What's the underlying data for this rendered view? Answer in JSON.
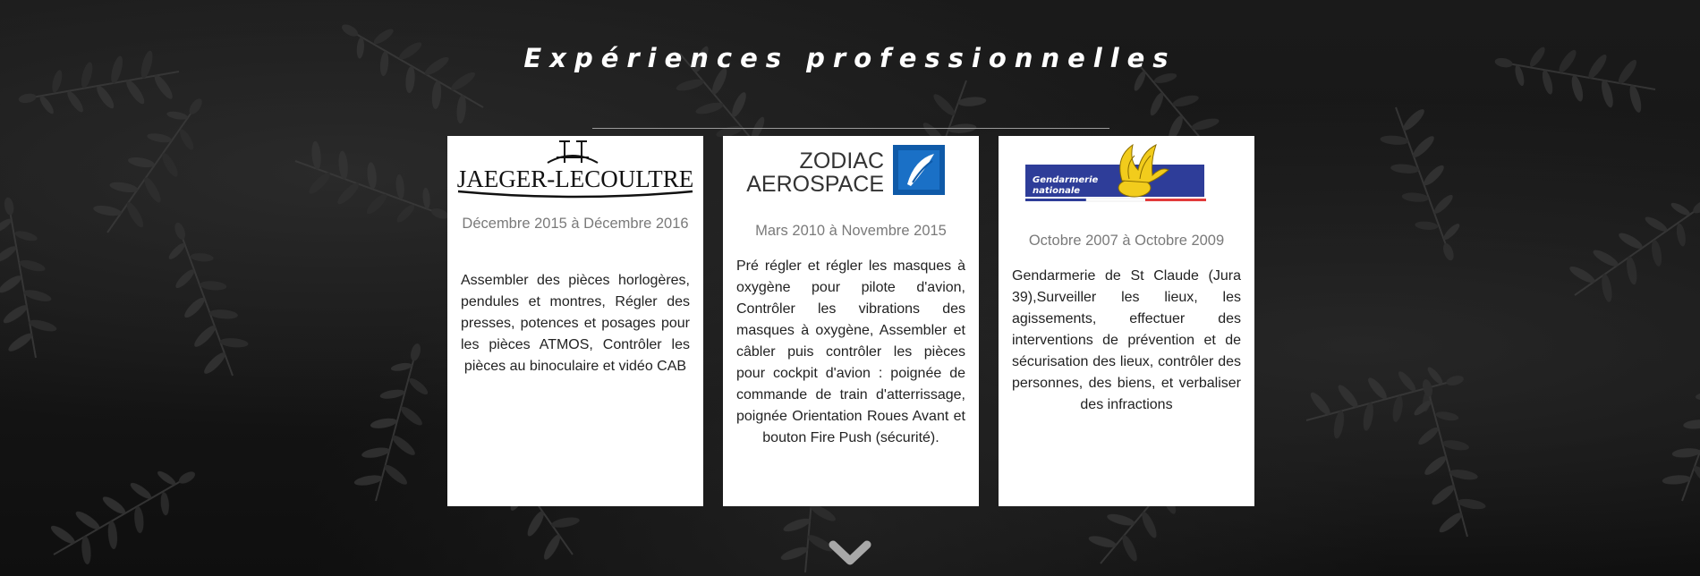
{
  "section": {
    "title": "Expériences professionnelles"
  },
  "experiences": [
    {
      "company": "Jaeger-LeCoultre",
      "logo_text": "JAEGER-LECOULTRE",
      "dates": "Décembre 2015 à Décembre 2016",
      "description": "Assembler des pièces horlogères, pendules et montres, Régler des presses, potences et posages pour les pièces ATMOS, Contrôler les pièces au binoculaire et vidéo CAB"
    },
    {
      "company": "Zodiac Aerospace",
      "logo_line1": "ZODIAC",
      "logo_line2": "AEROSPACE",
      "dates": "Mars 2010 à Novembre 2015",
      "description": "Pré régler et régler les masques à oxygène pour pilote d'avion, Contrôler les vibrations des masques à oxygène, Assembler et câbler puis contrôler les pièces pour cockpit d'avion : poignée de commande de train d'atterrissage, poignée Orientation Roues Avant et bouton Fire Push (sécurité)."
    },
    {
      "company": "Gendarmerie nationale",
      "logo_line1": "Gendarmerie",
      "logo_line2": "nationale",
      "dates": "Octobre 2007 à Octobre 2009",
      "description": "Gendarmerie de St Claude (Jura 39),Surveiller les lieux, les agissements, effectuer des interventions de prévention et de sécurisation des lieux, contrôler des personnes, des biens, et verbaliser des infractions"
    }
  ],
  "icons": {
    "scroll_down": "chevron-down-icon"
  },
  "colors": {
    "title": "#ffffff",
    "card_background": "#ffffff",
    "date_text": "#7a7a7a",
    "body_text": "#222222",
    "zodiac_blue": "#0f5aa8",
    "gendarmerie_blue": "#2e3d99",
    "gendarmerie_red": "#e23b3b",
    "gendarmerie_gold": "#f2cc1c"
  }
}
